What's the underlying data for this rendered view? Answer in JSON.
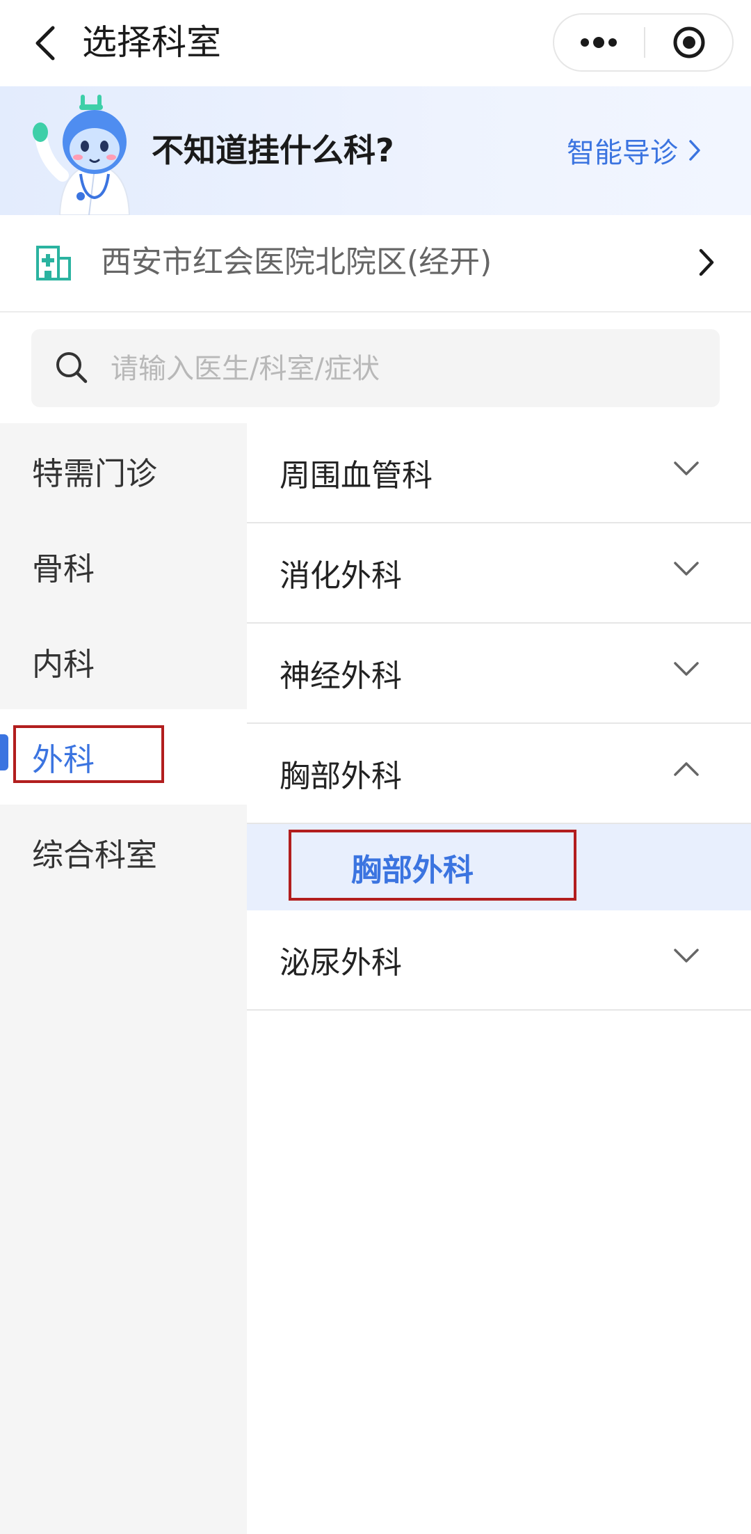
{
  "header": {
    "title": "选择科室",
    "icons": {
      "back": "chevron-left-icon",
      "more": "more-dots-icon",
      "close": "target-close-icon"
    }
  },
  "banner": {
    "question": "不知道挂什么科?",
    "smart_guide_label": "智能导诊",
    "mascot": "doctor-robot-mascot",
    "link_color": "#3b74e0"
  },
  "hospital": {
    "name": "西安市红会医院北院区(经开)",
    "icon": "hospital-icon",
    "icon_color": "#2bb3a0"
  },
  "search": {
    "placeholder": "请输入医生/科室/症状",
    "value": ""
  },
  "sidebar": {
    "active_index": 3,
    "accent_color": "#3b74e0",
    "items": [
      {
        "label": "特需门诊"
      },
      {
        "label": "骨科"
      },
      {
        "label": "内科"
      },
      {
        "label": "外科"
      },
      {
        "label": "综合科室"
      }
    ]
  },
  "departments": [
    {
      "label": "周围血管科",
      "expanded": false
    },
    {
      "label": "消化外科",
      "expanded": false
    },
    {
      "label": "神经外科",
      "expanded": false
    },
    {
      "label": "胸部外科",
      "expanded": true,
      "children": [
        {
          "label": "胸部外科"
        }
      ]
    },
    {
      "label": "泌尿外科",
      "expanded": false
    }
  ]
}
